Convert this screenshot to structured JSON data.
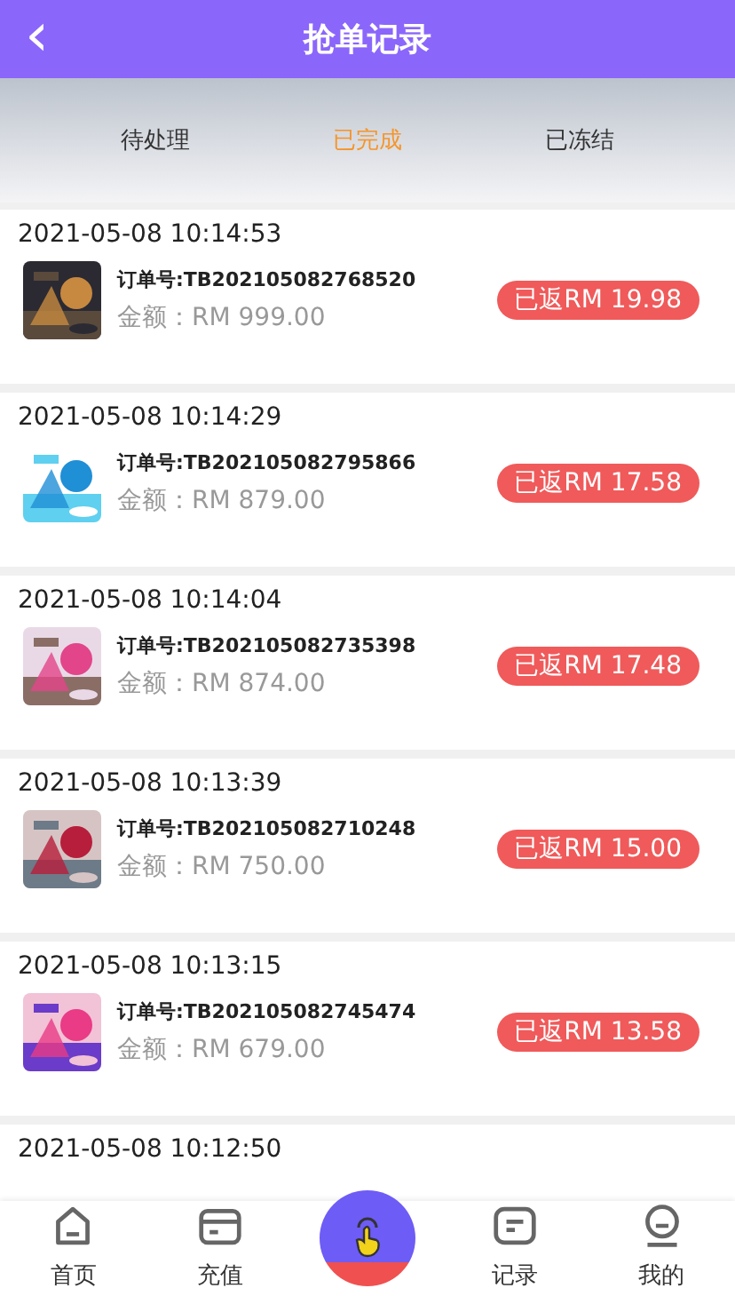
{
  "header": {
    "back": "‹",
    "title": "抢单记录"
  },
  "tabs": [
    {
      "label": "待处理",
      "selected": false
    },
    {
      "label": "已完成",
      "selected": true
    },
    {
      "label": "已冻结",
      "selected": false
    }
  ],
  "orders": [
    {
      "time": "2021-05-08 10:14:53",
      "order_no": "订单号:TB202105082768520",
      "amount": "金额：RM 999.00",
      "refund": "已返RM 19.98"
    },
    {
      "time": "2021-05-08 10:14:29",
      "order_no": "订单号:TB202105082795866",
      "amount": "金额：RM 879.00",
      "refund": "已返RM 17.58"
    },
    {
      "time": "2021-05-08 10:14:04",
      "order_no": "订单号:TB202105082735398",
      "amount": "金额：RM 874.00",
      "refund": "已返RM 17.48"
    },
    {
      "time": "2021-05-08 10:13:39",
      "order_no": "订单号:TB202105082710248",
      "amount": "金额：RM 750.00",
      "refund": "已返RM 15.00"
    },
    {
      "time": "2021-05-08 10:13:15",
      "order_no": "订单号:TB202105082745474",
      "amount": "金额：RM 679.00",
      "refund": "已返RM 13.58"
    },
    {
      "time": "2021-05-08 10:12:50"
    }
  ],
  "nav": [
    {
      "kind": "home",
      "label": "首页"
    },
    {
      "kind": "card",
      "label": "充值"
    },
    {
      "kind": "grab"
    },
    {
      "kind": "record",
      "label": "记录"
    },
    {
      "kind": "profile",
      "label": "我的"
    }
  ]
}
